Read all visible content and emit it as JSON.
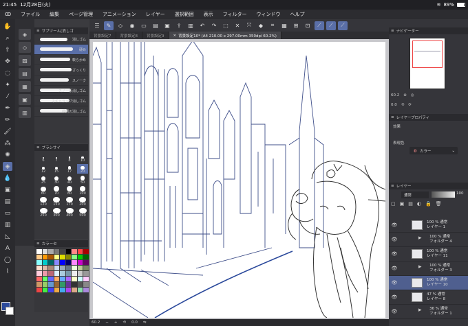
{
  "status_bar": {
    "time": "21:45",
    "date": "12月28日(火)",
    "battery": "89%"
  },
  "menu": [
    "ファイル",
    "編集",
    "ページ管理",
    "アニメーション",
    "レイヤー",
    "選択範囲",
    "表示",
    "フィルター",
    "ウィンドウ",
    "ヘルプ"
  ],
  "tabs": [
    "背景設定7",
    "背景設定8",
    "背景設定9",
    "背景設定10* (A4 210.00 x 297.00mm 350dpi 60.2%)"
  ],
  "subtool": {
    "title": "サブツール[消しゴ",
    "items": [
      {
        "label": "消しゴム",
        "selected": false
      },
      {
        "label": "硬め",
        "selected": true
      },
      {
        "label": "軟らかめ",
        "selected": false
      },
      {
        "label": "ざっくり",
        "selected": false
      },
      {
        "label": "スノーク",
        "selected": false
      },
      {
        "label": "スノー系消しゴム",
        "selected": false
      },
      {
        "label": "ネギトラップ消しゴム",
        "selected": false
      },
      {
        "label": "細網の消しゴム",
        "selected": false
      }
    ]
  },
  "brush_size": {
    "title": "ブラシサイ",
    "sizes": [
      "6",
      "7",
      "8",
      "10",
      "12",
      "15",
      "17",
      "20",
      "25",
      "30",
      "40",
      "50",
      "60",
      "70",
      "80",
      "100",
      "120",
      "150",
      "170",
      "200",
      "250",
      "300",
      "400",
      "500"
    ],
    "selected": "20"
  },
  "color_set": {
    "title": "カラーセ"
  },
  "navigator": {
    "title": "ナビゲーター",
    "zoom": "60.2",
    "rotation": "0.0"
  },
  "layer_property": {
    "title": "レイヤープロパティ",
    "effect_label": "効果",
    "expression_label": "表現色",
    "expression_value": "カラー"
  },
  "layers_panel": {
    "title": "レイヤー",
    "blend_mode": "通常",
    "opacity": "100",
    "layers": [
      {
        "line1": "100 % 通常",
        "line2": "レイヤー 1",
        "folder": false,
        "selected": false
      },
      {
        "line1": "100 % 通常",
        "line2": "フォルダー 4",
        "folder": true,
        "selected": false
      },
      {
        "line1": "100 % 通常",
        "line2": "レイヤー 11",
        "folder": false,
        "selected": false
      },
      {
        "line1": "100 % 通常",
        "line2": "フォルダー 3",
        "folder": true,
        "selected": false
      },
      {
        "line1": "100 % 通常",
        "line2": "レイヤー 10",
        "folder": false,
        "selected": true
      },
      {
        "line1": "47 % 通常",
        "line2": "レイヤー 8",
        "folder": false,
        "selected": false
      },
      {
        "line1": "36 % 通常",
        "line2": "フォルダー 1",
        "folder": true,
        "selected": false
      }
    ]
  },
  "bottom_bar": {
    "zoom": "60.2",
    "angle": "0.0"
  },
  "colors": {
    "accent": "#5a6fa8",
    "line_art": "#3f4f8a"
  }
}
